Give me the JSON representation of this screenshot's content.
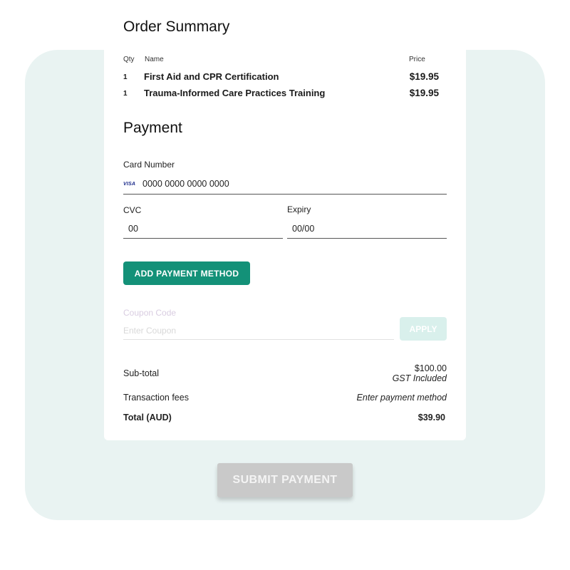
{
  "order_summary": {
    "title": "Order Summary",
    "columns": {
      "qty": "Qty",
      "name": "Name",
      "price": "Price"
    },
    "items": [
      {
        "qty": "1",
        "name": "First Aid and CPR Certification",
        "price": "$19.95"
      },
      {
        "qty": "1",
        "name": "Trauma-Informed Care Practices Training",
        "price": "$19.95"
      }
    ]
  },
  "payment": {
    "title": "Payment",
    "card_number_label": "Card Number",
    "card_brand_icon": "VISA",
    "card_number_value": "0000 0000 0000 0000",
    "cvc_label": "CVC",
    "cvc_value": "00",
    "expiry_label": "Expiry",
    "expiry_value": "00/00",
    "add_payment_method_label": "ADD PAYMENT METHOD"
  },
  "coupon": {
    "label": "Coupon Code",
    "placeholder": "Enter Coupon",
    "apply_label": "APPLY"
  },
  "totals": {
    "subtotal_label": "Sub-total",
    "subtotal_value": "$100.00",
    "subtotal_note": "GST Included",
    "fees_label": "Transaction fees",
    "fees_value": "Enter payment method",
    "total_label": "Total (AUD)",
    "total_value": "$39.90"
  },
  "submit_label": "SUBMIT PAYMENT",
  "colors": {
    "accent": "#139178",
    "panel_bg": "#e9f3f2",
    "submit_disabled": "#c9c9c9",
    "apply_disabled": "#d9f0ec"
  }
}
